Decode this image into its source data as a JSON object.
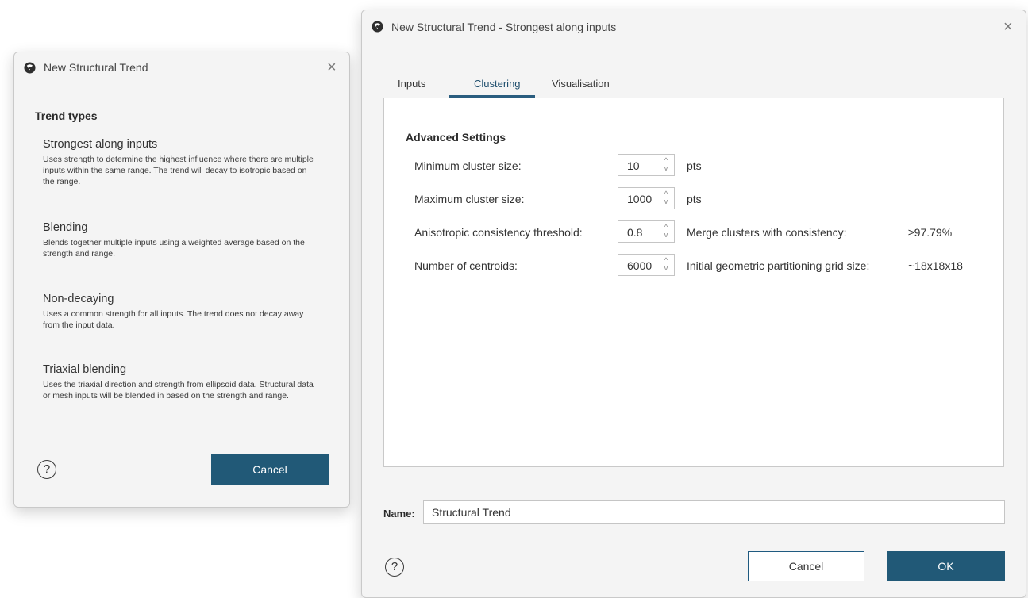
{
  "left_dialog": {
    "title": "New Structural Trend",
    "section_title": "Trend types",
    "trends": [
      {
        "name": "Strongest along inputs",
        "desc": "Uses strength to determine the highest influence where there are multiple inputs within the same range. The trend will decay to isotropic based on the range."
      },
      {
        "name": "Blending",
        "desc": "Blends together multiple inputs using a weighted average based on the strength and range."
      },
      {
        "name": "Non-decaying",
        "desc": "Uses a common strength for all inputs. The trend does not decay away from the input data."
      },
      {
        "name": "Triaxial blending",
        "desc": "Uses the triaxial direction and strength from ellipsoid data. Structural data or mesh inputs will be blended in based on the strength and range."
      }
    ],
    "help_label": "?",
    "cancel_label": "Cancel"
  },
  "right_dialog": {
    "title": "New Structural Trend - Strongest along inputs",
    "tabs": [
      "Inputs",
      "Clustering",
      "Visualisation"
    ],
    "active_tab": "Clustering",
    "advanced_title": "Advanced Settings",
    "rows": [
      {
        "label": "Minimum cluster size:",
        "value": "10",
        "unit": "pts",
        "extra_label": "",
        "extra_value": ""
      },
      {
        "label": "Maximum cluster size:",
        "value": "1000",
        "unit": "pts",
        "extra_label": "",
        "extra_value": ""
      },
      {
        "label": "Anisotropic consistency threshold:",
        "value": "0.8",
        "unit": "",
        "extra_label": "Merge clusters with consistency:",
        "extra_value": "≥97.79%"
      },
      {
        "label": "Number of centroids:",
        "value": "6000",
        "unit": "",
        "extra_label": "Initial geometric partitioning grid size:",
        "extra_value": "~18x18x18"
      }
    ],
    "name_label": "Name:",
    "name_value": "Structural Trend",
    "help_label": "?",
    "cancel_label": "Cancel",
    "ok_label": "OK"
  },
  "icons": {
    "app": "app-logo-icon",
    "close": "close-icon",
    "spin": "spinner-arrows-icon",
    "help": "help-icon"
  },
  "colors": {
    "primary_button": "#215977",
    "tab_underline": "#2a5d7f",
    "dialog_bg": "#f4f4f4"
  }
}
